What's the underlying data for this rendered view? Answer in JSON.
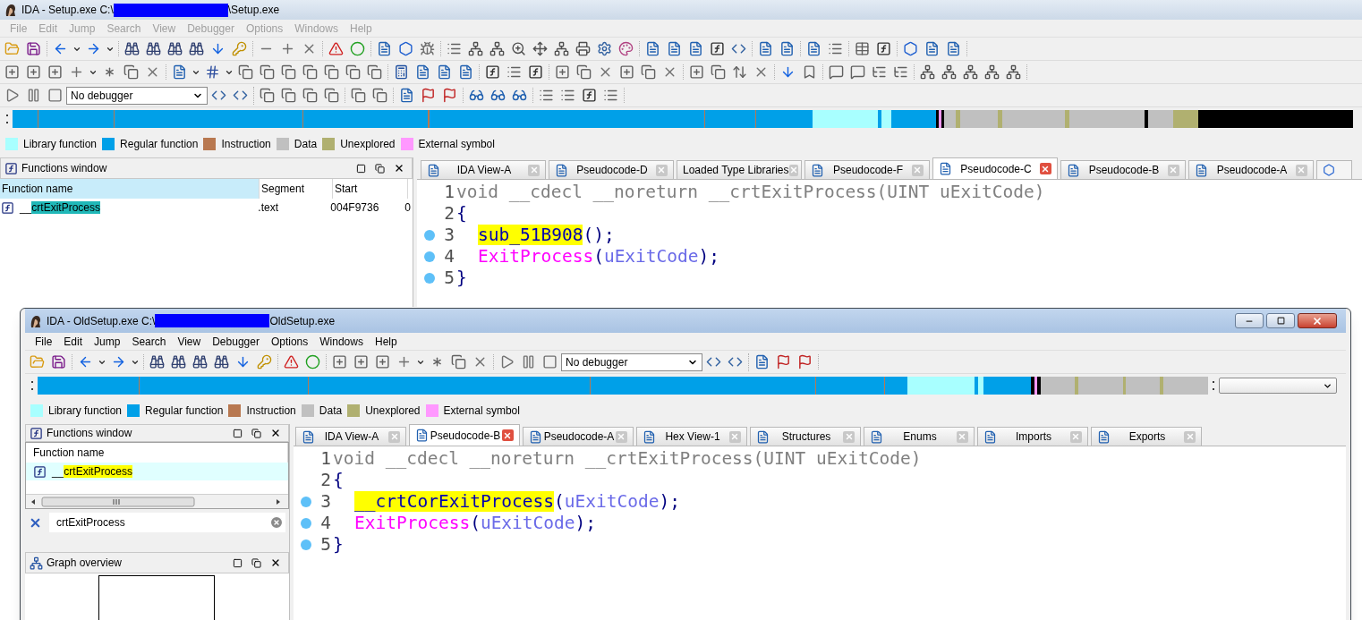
{
  "windows": [
    {
      "kind": "background",
      "active": false,
      "title": {
        "prefix": "IDA - Setup.exe C:\\",
        "suffix": "\\Setup.exe"
      },
      "menu": [
        "File",
        "Edit",
        "Jump",
        "Search",
        "View",
        "Debugger",
        "Options",
        "Windows",
        "Help"
      ],
      "debugger_select": {
        "value": "No debugger"
      },
      "legend": [
        {
          "label": "Library function",
          "color": "#a8ffff"
        },
        {
          "label": "Regular function",
          "color": "#00a0e8"
        },
        {
          "label": "Instruction",
          "color": "#b87850"
        },
        {
          "label": "Data",
          "color": "#c0c0c0"
        },
        {
          "label": "Unexplored",
          "color": "#b0b070"
        },
        {
          "label": "External symbol",
          "color": "#ff98ff"
        }
      ],
      "functions_window": {
        "title": "Functions window",
        "columns": [
          "Function name",
          "Segment",
          "Start"
        ],
        "rows": [
          {
            "selected": false,
            "cells": [
              {
                "prefix": "__",
                "match": "crtExitProcess"
              },
              ".text",
              "004F9736",
              "0"
            ]
          }
        ]
      },
      "tabs": [
        {
          "label": "IDA View-A",
          "selected": false
        },
        {
          "label": "Pseudocode-D",
          "selected": false
        },
        {
          "label": "Loaded Type Libraries",
          "selected": false
        },
        {
          "label": "Pseudocode-F",
          "selected": false
        },
        {
          "label": "Pseudocode-C",
          "selected": true
        },
        {
          "label": "Pseudocode-B",
          "selected": false
        },
        {
          "label": "Pseudocode-A",
          "selected": false
        }
      ],
      "code": [
        {
          "number": "1",
          "breakpoint": false,
          "indent": false,
          "tokens": [
            {
              "text": "void __cdecl __noreturn __crtExitProcess(UINT uExitCode)",
              "kind": "decl",
              "highlighted": false
            }
          ]
        },
        {
          "number": "2",
          "breakpoint": false,
          "indent": false,
          "tokens": [
            {
              "text": "{",
              "kind": "punct",
              "highlighted": false
            }
          ]
        },
        {
          "number": "3",
          "breakpoint": true,
          "indent": true,
          "tokens": [
            {
              "text": "sub_51B908",
              "kind": "func",
              "highlighted": true
            },
            {
              "text": "();",
              "kind": "punct",
              "highlighted": false
            }
          ]
        },
        {
          "number": "4",
          "breakpoint": true,
          "indent": true,
          "tokens": [
            {
              "text": "ExitProcess",
              "kind": "import",
              "highlighted": false
            },
            {
              "text": "(",
              "kind": "punct",
              "highlighted": false
            },
            {
              "text": "uExitCode",
              "kind": "var",
              "highlighted": false
            },
            {
              "text": ");",
              "kind": "punct",
              "highlighted": false
            }
          ]
        },
        {
          "number": "5",
          "breakpoint": true,
          "indent": false,
          "tokens": [
            {
              "text": "}",
              "kind": "punct",
              "highlighted": false
            }
          ]
        }
      ]
    },
    {
      "kind": "foreground",
      "active": true,
      "title": {
        "prefix": "IDA - OldSetup.exe C:\\",
        "suffix": "OldSetup.exe"
      },
      "menu": [
        "File",
        "Edit",
        "Jump",
        "Search",
        "View",
        "Debugger",
        "Options",
        "Windows",
        "Help"
      ],
      "debugger_select": {
        "value": "No debugger"
      },
      "legend": [
        {
          "label": "Library function",
          "color": "#a8ffff"
        },
        {
          "label": "Regular function",
          "color": "#00a0e8"
        },
        {
          "label": "Instruction",
          "color": "#b87850"
        },
        {
          "label": "Data",
          "color": "#c0c0c0"
        },
        {
          "label": "Unexplored",
          "color": "#b0b070"
        },
        {
          "label": "External symbol",
          "color": "#ff98ff"
        }
      ],
      "functions_window": {
        "title": "Functions window",
        "columns": [
          "Function name"
        ],
        "rows": [
          {
            "selected": true,
            "cells": [
              {
                "prefix": "__",
                "match": "crtExitProcess"
              }
            ]
          }
        ],
        "filter": {
          "value": "crtExitProcess"
        },
        "graph_overview": {
          "title": "Graph overview"
        }
      },
      "tabs": [
        {
          "label": "IDA View-A",
          "selected": false
        },
        {
          "label": "Pseudocode-B",
          "selected": true
        },
        {
          "label": "Pseudocode-A",
          "selected": false
        },
        {
          "label": "Hex View-1",
          "selected": false
        },
        {
          "label": "Structures",
          "selected": false
        },
        {
          "label": "Enums",
          "selected": false
        },
        {
          "label": "Imports",
          "selected": false
        },
        {
          "label": "Exports",
          "selected": false
        }
      ],
      "code": [
        {
          "number": "1",
          "breakpoint": false,
          "indent": false,
          "tokens": [
            {
              "text": "void __cdecl __noreturn __crtExitProcess(UINT uExitCode)",
              "kind": "decl",
              "highlighted": false
            }
          ]
        },
        {
          "number": "2",
          "breakpoint": false,
          "indent": false,
          "tokens": [
            {
              "text": "{",
              "kind": "punct",
              "highlighted": false
            }
          ]
        },
        {
          "number": "3",
          "breakpoint": true,
          "indent": true,
          "tokens": [
            {
              "text": "__crtCorExitProcess",
              "kind": "func",
              "highlighted": true
            },
            {
              "text": "(",
              "kind": "punct",
              "highlighted": false
            },
            {
              "text": "uExitCode",
              "kind": "var",
              "highlighted": false
            },
            {
              "text": ");",
              "kind": "punct",
              "highlighted": false
            }
          ]
        },
        {
          "number": "4",
          "breakpoint": true,
          "indent": true,
          "tokens": [
            {
              "text": "ExitProcess",
              "kind": "import",
              "highlighted": false
            },
            {
              "text": "(",
              "kind": "punct",
              "highlighted": false
            },
            {
              "text": "uExitCode",
              "kind": "var",
              "highlighted": false
            },
            {
              "text": ");",
              "kind": "punct",
              "highlighted": false
            }
          ]
        },
        {
          "number": "5",
          "breakpoint": true,
          "indent": false,
          "tokens": [
            {
              "text": "}",
              "kind": "punct",
              "highlighted": false
            }
          ]
        }
      ]
    }
  ]
}
